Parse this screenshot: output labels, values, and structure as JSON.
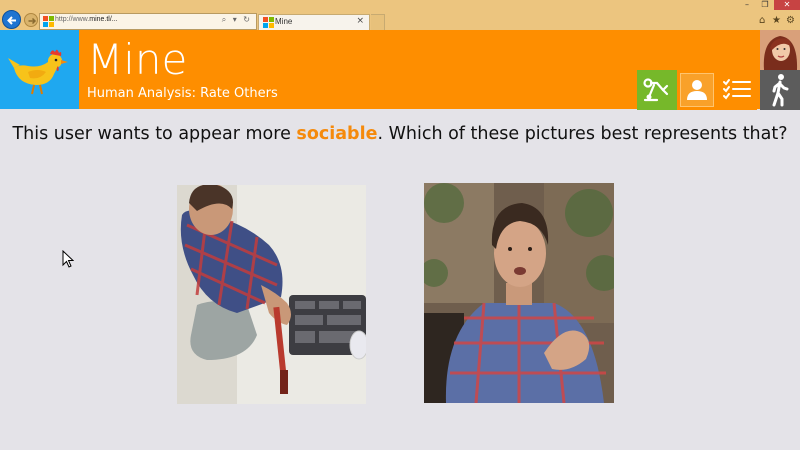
{
  "browser": {
    "url_prefix": "http://www.",
    "url_domain": "mine.tl/...",
    "url_tools": "⌕ ▾ ↻",
    "tab_title": "Mine",
    "tab_close": "×",
    "window_controls": {
      "minimize": "–",
      "maximize": "❐",
      "close": "✕"
    },
    "tool_icons": {
      "home": "⌂",
      "favorites": "★",
      "settings": "⚙"
    }
  },
  "header": {
    "title": "Mine",
    "subtitle": "Human Analysis: Rate Others",
    "accent_color": "#fe8e00",
    "logo_color": "#1fa8f0",
    "buttons": [
      {
        "name": "robot-icon",
        "color": "#76b82a"
      },
      {
        "name": "user-icon",
        "color": "#fe8e00"
      },
      {
        "name": "checklist-icon",
        "color": "#fe8e00"
      },
      {
        "name": "walking-person-icon",
        "color": "#5c5c5c"
      }
    ]
  },
  "question": {
    "prefix": "This user wants to appear more ",
    "highlight": "sociable",
    "suffix": ". Which of these pictures best represents that?",
    "highlight_color": "#f58a0c"
  },
  "photos": [
    {
      "subject": "man in plaid shirt kneeling with toolbox and screwdriver"
    },
    {
      "subject": "man in plaid shirt talking and gesturing outdoors"
    }
  ]
}
